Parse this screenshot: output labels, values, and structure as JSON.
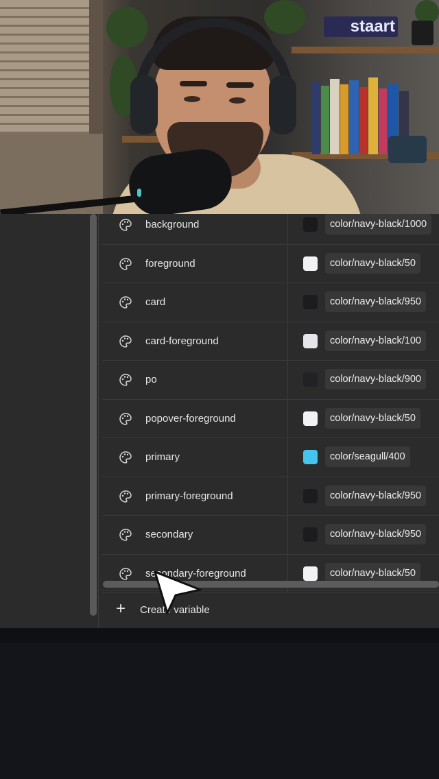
{
  "webcam": {
    "logo_text": "staart"
  },
  "variables": {
    "rows": [
      {
        "name": "background",
        "value": "color/navy-black/1000",
        "swatch": "#1a1a1c"
      },
      {
        "name": "foreground",
        "value": "color/navy-black/50",
        "swatch": "#f2f2f4"
      },
      {
        "name": "card",
        "value": "color/navy-black/950",
        "swatch": "#1c1c1f"
      },
      {
        "name": "card-foreground",
        "value": "color/navy-black/100",
        "swatch": "#e6e6ea"
      },
      {
        "name": "po",
        "value": "color/navy-black/900",
        "swatch": "#222226"
      },
      {
        "name": "popover-foreground",
        "value": "color/navy-black/50",
        "swatch": "#f2f2f4"
      },
      {
        "name": "primary",
        "value": "color/seagull/400",
        "swatch": "#45c4ee"
      },
      {
        "name": "primary-foreground",
        "value": "color/navy-black/950",
        "swatch": "#1c1c1f"
      },
      {
        "name": "secondary",
        "value": "color/navy-black/950",
        "swatch": "#1c1c1f"
      },
      {
        "name": "secondary-foreground",
        "value": "color/navy-black/50",
        "swatch": "#f2f2f4"
      }
    ],
    "create_label": "Create variable",
    "create_icon": "plus-icon",
    "row_icon": "palette-icon"
  }
}
